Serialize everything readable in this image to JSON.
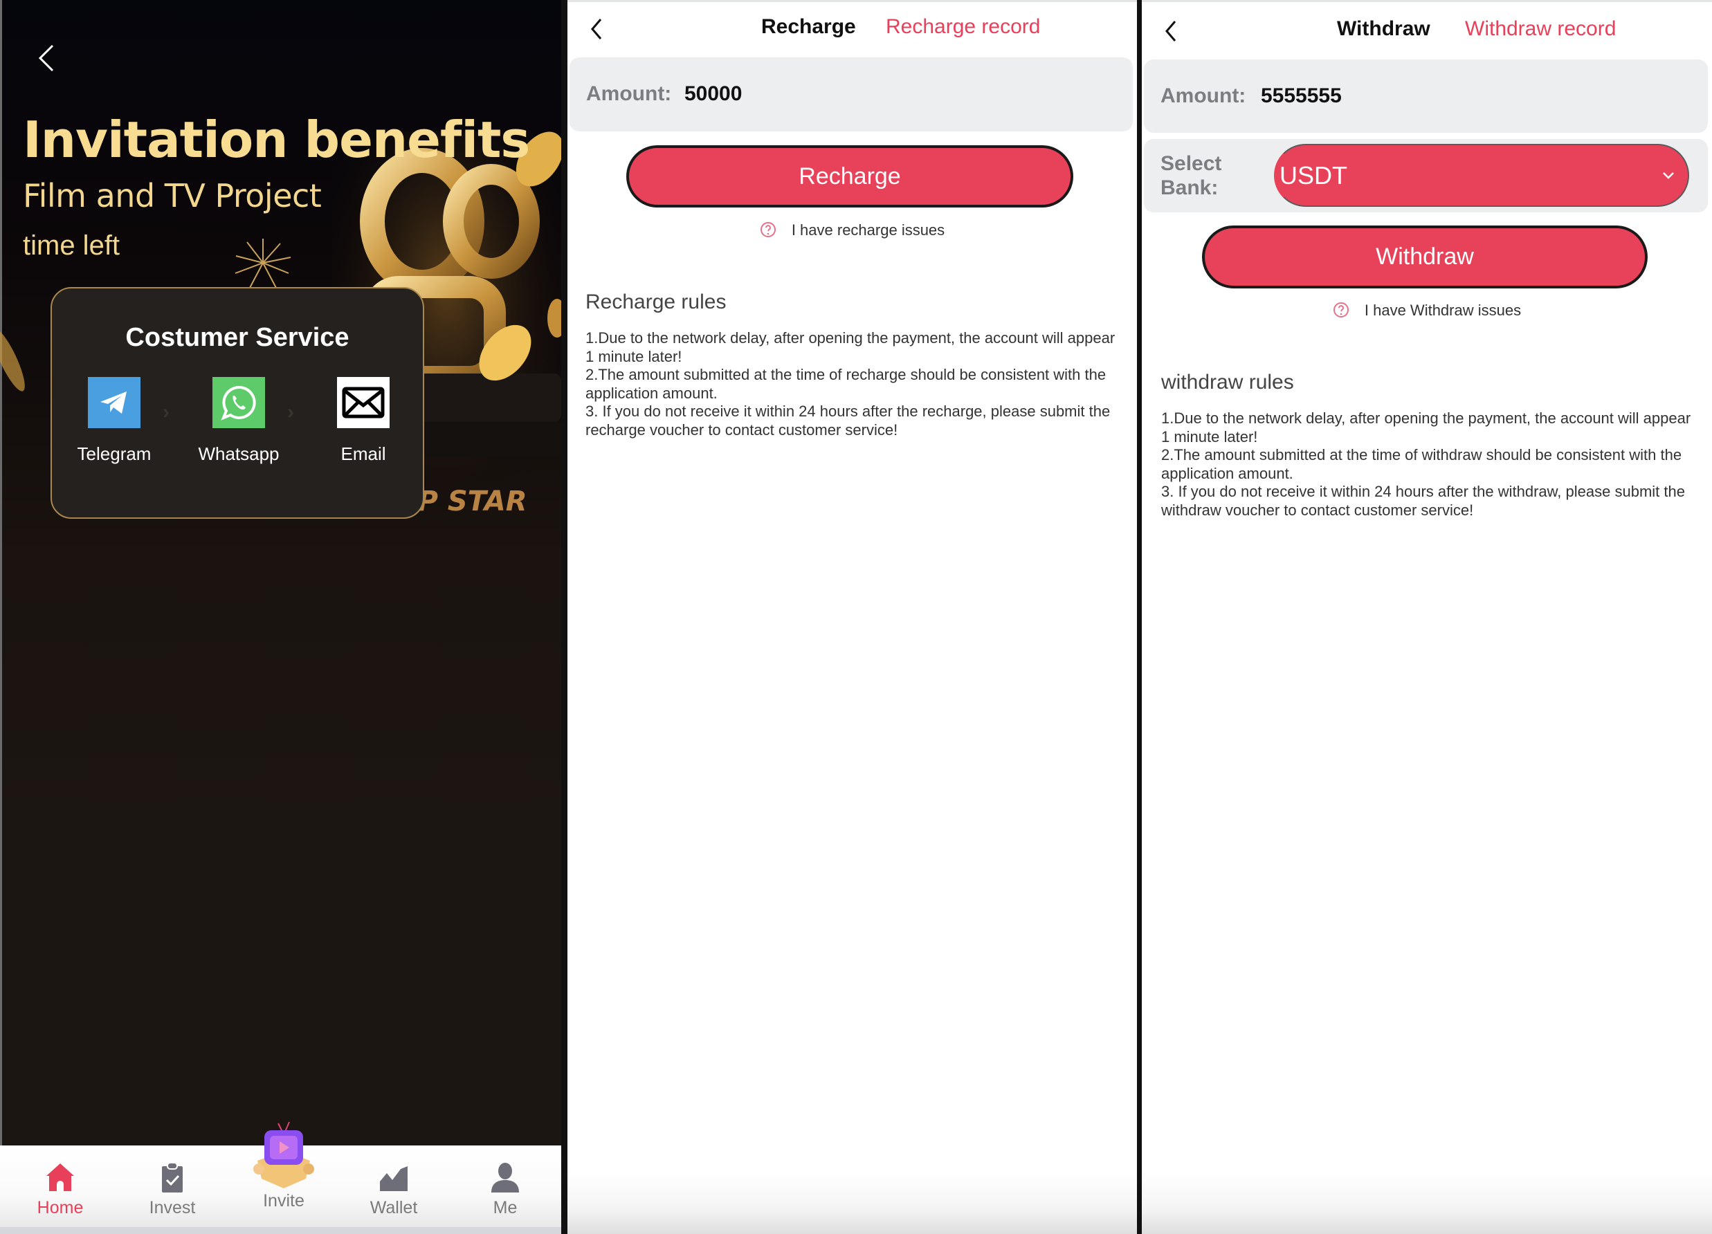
{
  "invite_screen": {
    "title": "Invitation benefits",
    "subtitle": "Film and TV Project",
    "time_left_label": "time left",
    "banner_caption": "IN TOP STAR",
    "customer_service": {
      "title": "Costumer Service",
      "items": [
        {
          "label": "Telegram",
          "icon": "telegram-icon",
          "color": "#4a9fe0"
        },
        {
          "label": "Whatsapp",
          "icon": "whatsapp-icon",
          "color": "#5ecb6a"
        },
        {
          "label": "Email",
          "icon": "envelope-icon",
          "color": "#ffffff"
        }
      ]
    },
    "tabbar": {
      "active": "Home",
      "active_color": "#e8405a",
      "items": [
        {
          "label": "Home",
          "icon": "home-icon"
        },
        {
          "label": "Invest",
          "icon": "clipboard-check-icon"
        },
        {
          "label": "Invite",
          "icon": "tv-gift-icon"
        },
        {
          "label": "Wallet",
          "icon": "chart-line-icon"
        },
        {
          "label": "Me",
          "icon": "user-icon"
        }
      ]
    }
  },
  "recharge_screen": {
    "title": "Recharge",
    "record_link": "Recharge record",
    "amount_label": "Amount:",
    "amount_value": "50000",
    "submit_label": "Recharge",
    "issues_label": "I have recharge issues",
    "rules_title": "Recharge rules",
    "rules": [
      "1.Due to the network delay, after opening the payment, the account will appear 1 minute later!",
      "2.The amount submitted at the time of recharge should be consistent with the application amount.",
      "3. If you do not receive it within 24 hours after the recharge, please submit the recharge voucher to contact customer service!"
    ]
  },
  "withdraw_screen": {
    "title": "Withdraw",
    "record_link": "Withdraw record",
    "amount_label": "Amount:",
    "amount_value": "5555555",
    "bank_label": "Select Bank:",
    "bank_value": "USDT",
    "submit_label": "Withdraw",
    "issues_label": "I have Withdraw issues",
    "rules_title": "withdraw rules",
    "rules": [
      "1.Due to the network delay, after opening the payment, the account will appear 1 minute later!",
      "2.The amount submitted at the time of withdraw should be consistent with the application amount.",
      "3. If you do not receive it within 24 hours after the withdraw, please submit the withdraw voucher to contact customer service!"
    ]
  },
  "theme": {
    "accent": "#e8425a",
    "gold": "#f7dc91",
    "field_bg": "#eceeef"
  }
}
